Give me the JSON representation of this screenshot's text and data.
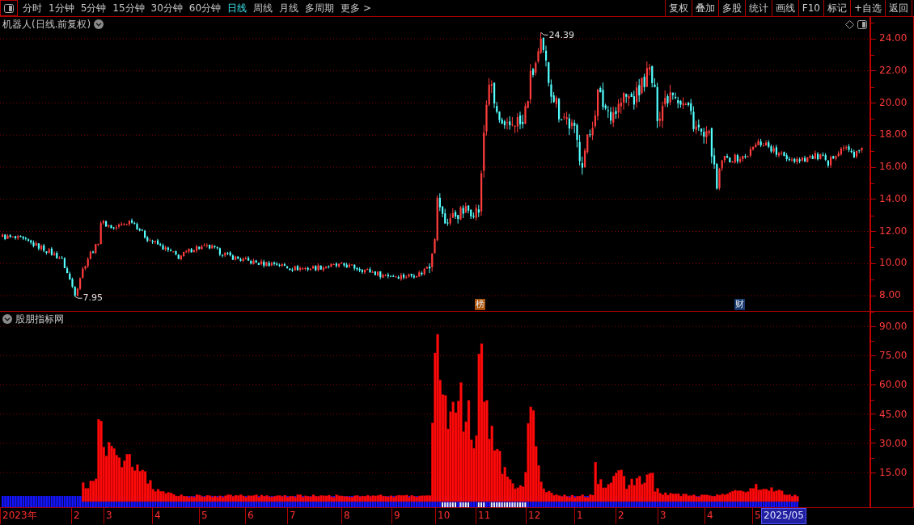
{
  "toolbar": {
    "tabs": [
      {
        "label": "分时",
        "selected": false
      },
      {
        "label": "1分钟",
        "selected": false
      },
      {
        "label": "5分钟",
        "selected": false
      },
      {
        "label": "15分钟",
        "selected": false
      },
      {
        "label": "30分钟",
        "selected": false
      },
      {
        "label": "60分钟",
        "selected": false
      },
      {
        "label": "日线",
        "selected": true
      },
      {
        "label": "周线",
        "selected": false
      },
      {
        "label": "月线",
        "selected": false
      },
      {
        "label": "多周期",
        "selected": false
      },
      {
        "label": "更多 >",
        "selected": false
      }
    ],
    "buttons": [
      "复权",
      "叠加",
      "多股",
      "统计",
      "画线",
      "F10",
      "标记",
      "+自选",
      "返回"
    ]
  },
  "price_panel": {
    "title": "机器人(日线.前复权)",
    "axis_labels": [
      "24.00",
      "22.00",
      "20.00",
      "18.00",
      "16.00",
      "14.00",
      "12.00",
      "10.00",
      "8.00"
    ],
    "high_label": "24.39",
    "low_label": "7.95",
    "markers": [
      {
        "text": "榜",
        "color": "#a85008"
      },
      {
        "text": "财",
        "color": "#183a70"
      }
    ]
  },
  "indicator_panel": {
    "title": "股朋指标网",
    "axis_labels": [
      "90.00",
      "75.00",
      "60.00",
      "45.00",
      "30.00",
      "15.00"
    ]
  },
  "date_axis": [
    {
      "label": "2023年",
      "kind": "tick"
    },
    {
      "label": "2",
      "kind": "tick"
    },
    {
      "label": "3",
      "kind": "tick"
    },
    {
      "label": "4",
      "kind": "tick"
    },
    {
      "label": "5",
      "kind": "tick"
    },
    {
      "label": "6",
      "kind": "tick"
    },
    {
      "label": "7",
      "kind": "tick"
    },
    {
      "label": "8",
      "kind": "tick"
    },
    {
      "label": "9",
      "kind": "tick"
    },
    {
      "label": "10",
      "kind": "tick"
    },
    {
      "label": "11",
      "kind": "tick"
    },
    {
      "label": "12",
      "kind": "tick"
    },
    {
      "label": "1",
      "kind": "tick"
    },
    {
      "label": "2",
      "kind": "tick"
    },
    {
      "label": "3",
      "kind": "tick"
    },
    {
      "label": "4",
      "kind": "tick"
    },
    {
      "label": "5",
      "kind": "tick"
    },
    {
      "label": "2025/05",
      "kind": "cursor"
    }
  ]
}
